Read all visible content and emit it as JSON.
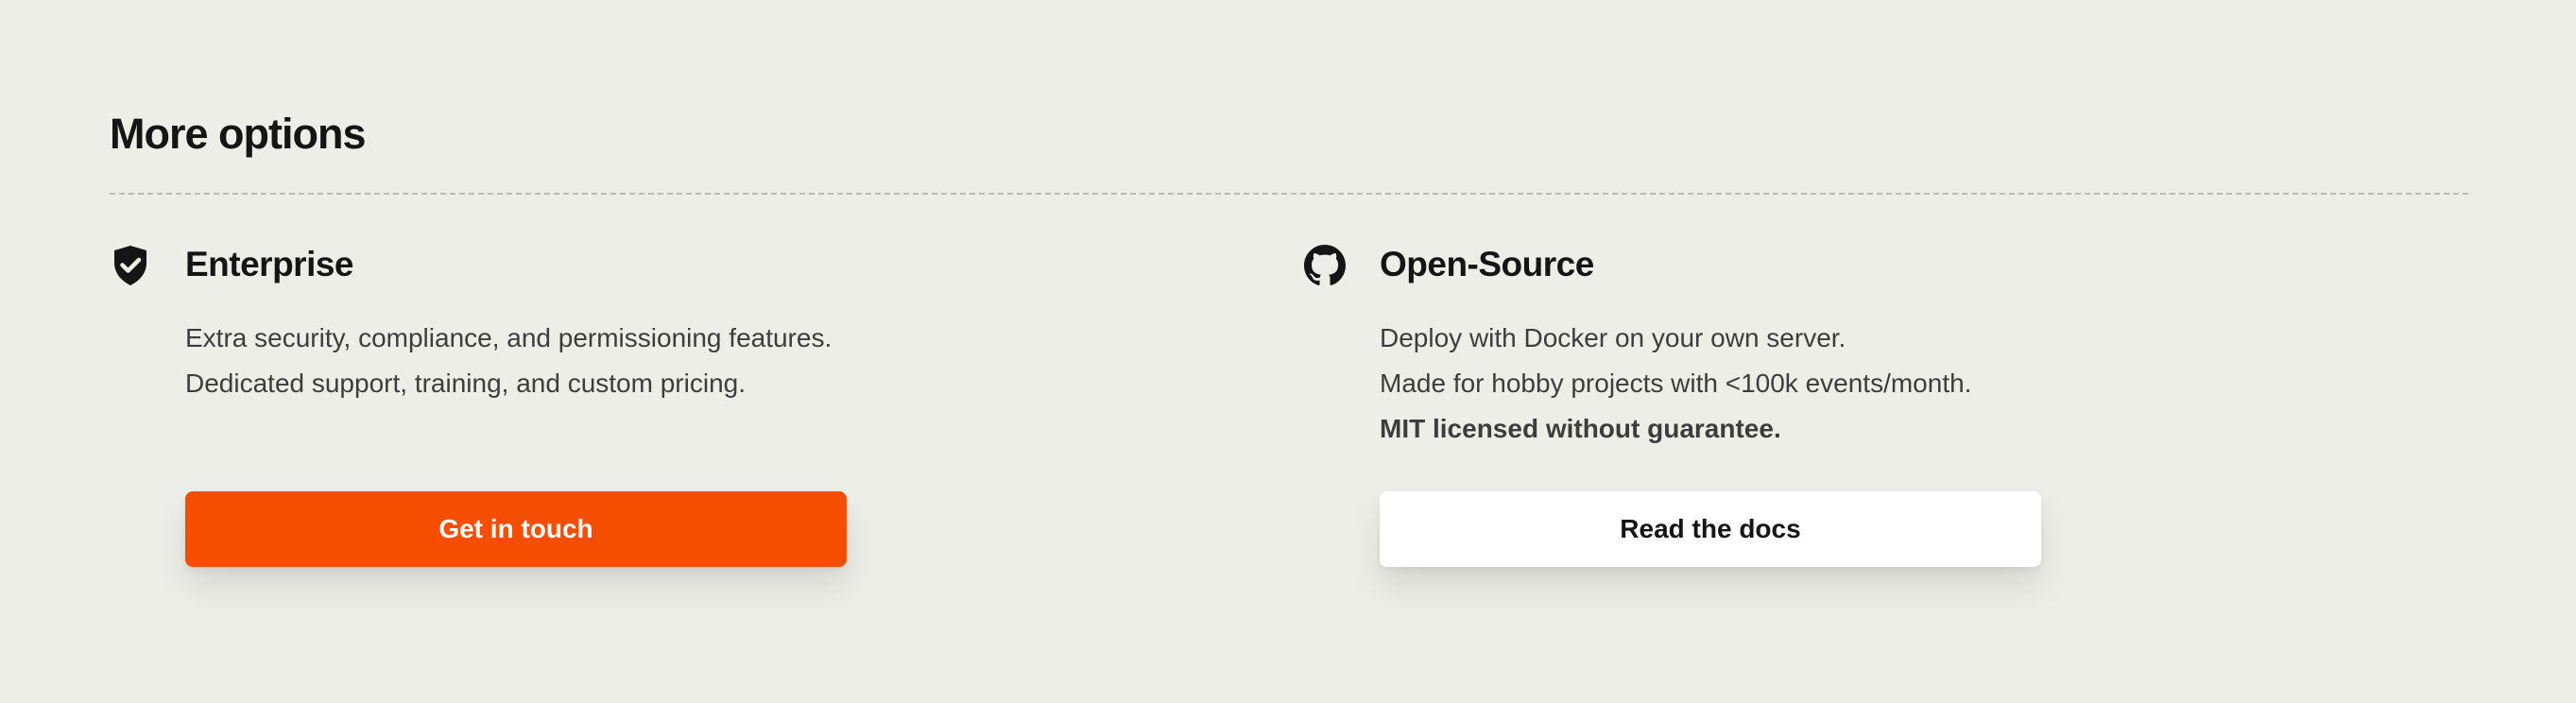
{
  "section": {
    "title": "More options"
  },
  "options": [
    {
      "icon": "shield-check-icon",
      "title": "Enterprise",
      "lines": [
        "Extra security, compliance, and permissioning features.",
        "Dedicated support, training, and custom pricing."
      ],
      "button_label": "Get in touch"
    },
    {
      "icon": "github-icon",
      "title": "Open-Source",
      "lines": [
        "Deploy with Docker on your own server.",
        "Made for hobby projects with <100k events/month."
      ],
      "strong_line": "MIT licensed without guarantee.",
      "button_label": "Read the docs"
    }
  ],
  "colors": {
    "background": "#eeeee8",
    "primary_button": "#f54e00",
    "secondary_button": "#ffffff",
    "heading_text": "#151515",
    "body_text": "#3d3d3d"
  }
}
